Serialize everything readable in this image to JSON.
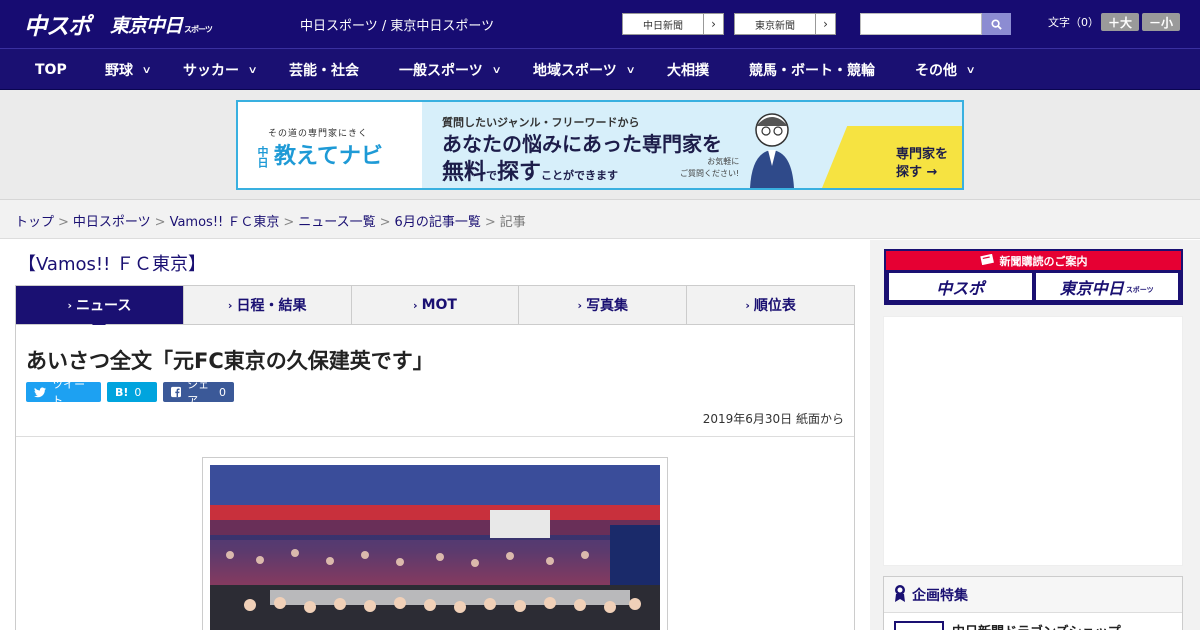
{
  "header": {
    "logo_chuspo": "中スポ",
    "logo_tokyo": "東京中日",
    "logo_tokyo_small": "スポーツ",
    "site_title": "中日スポーツ / 東京中日スポーツ",
    "paper_links": [
      {
        "label": "中日新聞",
        "arrow": "›"
      },
      {
        "label": "東京新聞",
        "arrow": "›"
      }
    ],
    "search": {
      "placeholder": "",
      "button_icon": "search-icon"
    },
    "font_size_label": "文字（0）",
    "font_large_label": "＋大",
    "font_small_label": "－小"
  },
  "nav": {
    "items": [
      {
        "label": "TOP",
        "has_dropdown": false
      },
      {
        "label": "野球",
        "has_dropdown": true
      },
      {
        "label": "サッカー",
        "has_dropdown": true
      },
      {
        "label": "芸能・社会",
        "has_dropdown": false
      },
      {
        "label": "一般スポーツ",
        "has_dropdown": true
      },
      {
        "label": "地域スポーツ",
        "has_dropdown": true
      },
      {
        "label": "大相撲",
        "has_dropdown": false
      },
      {
        "label": "競馬・ボート・競輪",
        "has_dropdown": false
      },
      {
        "label": "その他",
        "has_dropdown": true
      }
    ]
  },
  "banner": {
    "tagline": "その道の専門家にきく",
    "logo_prefix": "中日",
    "logo": "教えてナビ",
    "line1": "質問したいジャンル・フリーワードから",
    "line2": "あなたの悩みにあった専門家を",
    "line3_a": "無料",
    "line3_b": "で",
    "line3_c": "探す",
    "line3_d": "ことができます",
    "note_1": "お気軽に",
    "note_2": "ご質問ください!",
    "cta_1": "専門家を",
    "cta_2": "探す →"
  },
  "breadcrumb": {
    "items": [
      "トップ",
      "中日スポーツ",
      "Vamos!! ＦＣ東京",
      "ニュース一覧",
      "6月の記事一覧"
    ],
    "separator": ">",
    "current": "記事"
  },
  "column_title": "【Vamos!! ＦＣ東京】",
  "tabs": [
    {
      "label": "ニュース",
      "active": true
    },
    {
      "label": "日程・結果",
      "active": false
    },
    {
      "label": "MOT",
      "active": false
    },
    {
      "label": "写真集",
      "active": false
    },
    {
      "label": "順位表",
      "active": false
    }
  ],
  "tab_chevron": "›",
  "article": {
    "title": "あいさつ全文「元FC東京の久保建英です」",
    "share": {
      "twitter_icon": "twitter-icon",
      "twitter_label": "ツイート",
      "hatena_label": "B!",
      "hatena_count": "0",
      "facebook_icon": "facebook-icon",
      "facebook_label": "シェア",
      "facebook_count": "0"
    },
    "date": "2019年6月30日 紙面から"
  },
  "sidebar": {
    "subscribe_head": "新聞購読のご案内",
    "subscribe_logo_1": "中スポ",
    "subscribe_logo_2": "東京中日",
    "subscribe_logo_2_small": "スポーツ",
    "feature_head": "企画特集",
    "feature_item": "中日新聞ドラゴンズショップ"
  },
  "colors": {
    "brand_navy": "#170c72",
    "accent_red": "#e60033",
    "banner_border": "#39b0e0",
    "twitter": "#1da1f2",
    "hatena": "#00a4de",
    "facebook": "#3b5998"
  }
}
